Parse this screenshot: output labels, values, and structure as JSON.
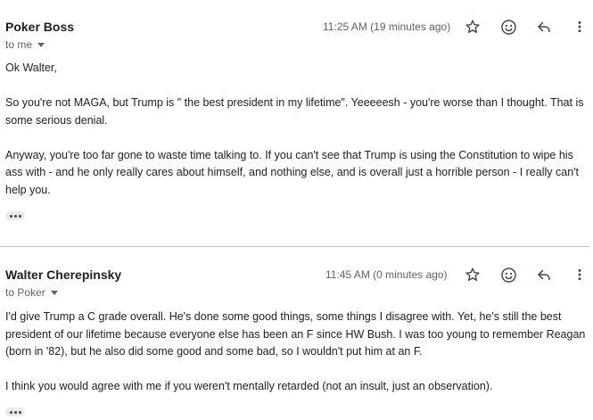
{
  "messages": [
    {
      "sender": "Poker Boss",
      "recipient": "to me",
      "time": "11:25 AM (19 minutes ago)",
      "body": [
        "Ok Walter,",
        "So you're not MAGA, but Trump is \" the best president in my lifetime\". Yeeeeesh - you're worse than I thought. That is some serious denial.",
        "Anyway, you're too far gone to waste time talking to. If you can't see that Trump is using the Constitution to wipe his ass with - and he only really cares about himself, and nothing else, and is overall just a horrible person -  I really can't help you."
      ]
    },
    {
      "sender": "Walter Cherepinsky",
      "recipient": "to Poker",
      "time": "11:45 AM (0 minutes ago)",
      "body": [
        "I'd give Trump a C grade overall. He's done some good things, some things I disagree with. Yet, he's still the best president of our lifetime because everyone else has been an F since HW Bush. I was too young to remember Reagan (born in '82), but he also did some good and some bad, so I wouldn't put him at an F.",
        "I think you would agree with me if you weren't mentally retarded (not an insult, just an observation)."
      ]
    }
  ],
  "icons": [
    "star-icon",
    "emoji-icon",
    "reply-icon",
    "more-vert-icon",
    "show-trimmed-icon"
  ]
}
